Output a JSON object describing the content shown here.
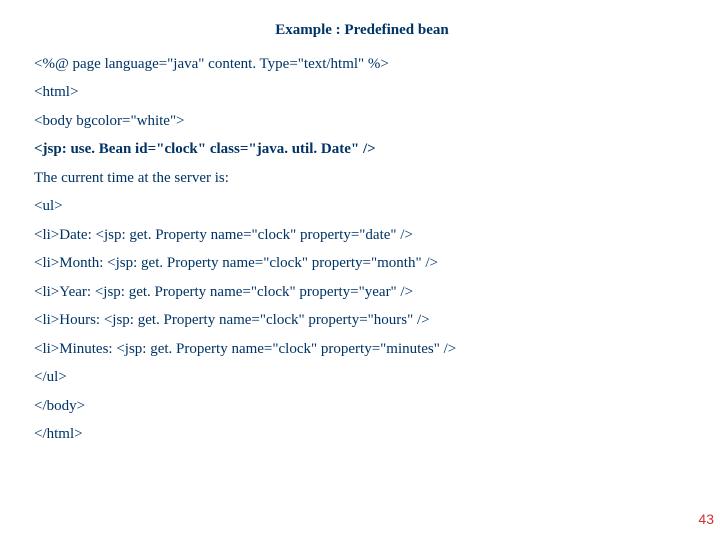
{
  "title": "Example :  Predefined bean",
  "lines": [
    "<%@ page language=\"java\" content. Type=\"text/html\" %>",
    "<html>",
    "<body bgcolor=\"white\">"
  ],
  "bold_line": "<jsp: use. Bean id=\"clock\" class=\"java. util. Date\" />",
  "lines2": [
    "The current time at the server is:",
    "<ul>",
    "<li>Date: <jsp: get. Property name=\"clock\" property=\"date\" />",
    "<li>Month: <jsp: get. Property name=\"clock\" property=\"month\" />",
    "<li>Year: <jsp: get. Property name=\"clock\" property=\"year\" />",
    "<li>Hours: <jsp: get. Property name=\"clock\" property=\"hours\" />",
    "<li>Minutes: <jsp: get. Property name=\"clock\" property=\"minutes\" />",
    "</ul>",
    "</body>",
    "</html>"
  ],
  "page_number": "43"
}
